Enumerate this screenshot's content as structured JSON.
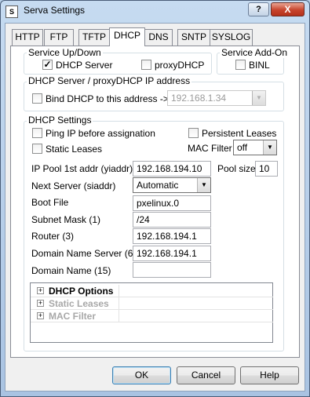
{
  "window": {
    "title": "Serva Settings",
    "app_icon": "S",
    "help_label": "?",
    "close_label": "X"
  },
  "tabs": [
    {
      "label": "HTTP"
    },
    {
      "label": "FTP"
    },
    {
      "label": "TFTP"
    },
    {
      "label": "DHCP",
      "active": true
    },
    {
      "label": "DNS"
    },
    {
      "label": "SNTP"
    },
    {
      "label": "SYSLOG"
    }
  ],
  "service_up_down": {
    "title": "Service Up/Down",
    "dhcp_server": {
      "label": "DHCP Server",
      "checked": true
    },
    "proxy_dhcp": {
      "label": "proxyDHCP",
      "checked": false
    }
  },
  "service_addon": {
    "title": "Service Add-On",
    "binl": {
      "label": "BINL",
      "checked": false
    }
  },
  "bind_address": {
    "title": "DHCP Server / proxyDHCP IP address",
    "checkbox_label": "Bind DHCP to this address  ->",
    "address": "192.168.1.34"
  },
  "dhcp_settings": {
    "title": "DHCP Settings",
    "ping_ip": "Ping IP before assignation",
    "persistent_leases": "Persistent Leases",
    "static_leases": "Static Leases",
    "mac_filter_label": "MAC Filter",
    "mac_filter_value": "off",
    "ip_pool_label": "IP Pool 1st addr (yiaddr)",
    "ip_pool_value": "192.168.194.10",
    "pool_size_label": "Pool size",
    "pool_size_value": "10",
    "next_server_label": "Next Server (siaddr)",
    "next_server_value": "Automatic",
    "boot_file_label": "Boot File",
    "boot_file_value": "pxelinux.0",
    "subnet_mask_label": "Subnet Mask  (1)",
    "subnet_mask_value": "/24",
    "router_label": "Router  (3)",
    "router_value": "192.168.194.1",
    "dns_label": "Domain Name Server  (6)",
    "dns_value": "192.168.194.1",
    "domain_name_label": "Domain Name  (15)",
    "domain_name_value": ""
  },
  "tree": {
    "expander": "+",
    "items": [
      {
        "label": "DHCP Options",
        "enabled": true
      },
      {
        "label": "Static Leases",
        "enabled": false
      },
      {
        "label": "MAC Filter",
        "enabled": false
      }
    ]
  },
  "buttons": {
    "ok": "OK",
    "cancel": "Cancel",
    "help": "Help"
  },
  "colors": {
    "accent": "#3c7fb1",
    "close_button": "#c7432c"
  }
}
